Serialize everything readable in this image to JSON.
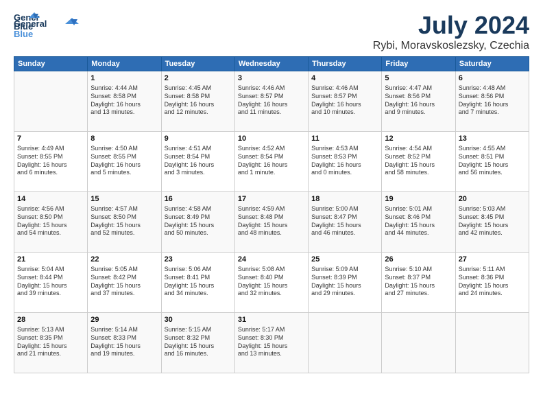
{
  "logo": {
    "line1": "General",
    "line2": "Blue"
  },
  "title": "July 2024",
  "subtitle": "Rybi, Moravskoslezsky, Czechia",
  "days_header": [
    "Sunday",
    "Monday",
    "Tuesday",
    "Wednesday",
    "Thursday",
    "Friday",
    "Saturday"
  ],
  "weeks": [
    [
      {
        "day": "",
        "info": ""
      },
      {
        "day": "1",
        "info": "Sunrise: 4:44 AM\nSunset: 8:58 PM\nDaylight: 16 hours\nand 13 minutes."
      },
      {
        "day": "2",
        "info": "Sunrise: 4:45 AM\nSunset: 8:58 PM\nDaylight: 16 hours\nand 12 minutes."
      },
      {
        "day": "3",
        "info": "Sunrise: 4:46 AM\nSunset: 8:57 PM\nDaylight: 16 hours\nand 11 minutes."
      },
      {
        "day": "4",
        "info": "Sunrise: 4:46 AM\nSunset: 8:57 PM\nDaylight: 16 hours\nand 10 minutes."
      },
      {
        "day": "5",
        "info": "Sunrise: 4:47 AM\nSunset: 8:56 PM\nDaylight: 16 hours\nand 9 minutes."
      },
      {
        "day": "6",
        "info": "Sunrise: 4:48 AM\nSunset: 8:56 PM\nDaylight: 16 hours\nand 7 minutes."
      }
    ],
    [
      {
        "day": "7",
        "info": "Sunrise: 4:49 AM\nSunset: 8:55 PM\nDaylight: 16 hours\nand 6 minutes."
      },
      {
        "day": "8",
        "info": "Sunrise: 4:50 AM\nSunset: 8:55 PM\nDaylight: 16 hours\nand 5 minutes."
      },
      {
        "day": "9",
        "info": "Sunrise: 4:51 AM\nSunset: 8:54 PM\nDaylight: 16 hours\nand 3 minutes."
      },
      {
        "day": "10",
        "info": "Sunrise: 4:52 AM\nSunset: 8:54 PM\nDaylight: 16 hours\nand 1 minute."
      },
      {
        "day": "11",
        "info": "Sunrise: 4:53 AM\nSunset: 8:53 PM\nDaylight: 16 hours\nand 0 minutes."
      },
      {
        "day": "12",
        "info": "Sunrise: 4:54 AM\nSunset: 8:52 PM\nDaylight: 15 hours\nand 58 minutes."
      },
      {
        "day": "13",
        "info": "Sunrise: 4:55 AM\nSunset: 8:51 PM\nDaylight: 15 hours\nand 56 minutes."
      }
    ],
    [
      {
        "day": "14",
        "info": "Sunrise: 4:56 AM\nSunset: 8:50 PM\nDaylight: 15 hours\nand 54 minutes."
      },
      {
        "day": "15",
        "info": "Sunrise: 4:57 AM\nSunset: 8:50 PM\nDaylight: 15 hours\nand 52 minutes."
      },
      {
        "day": "16",
        "info": "Sunrise: 4:58 AM\nSunset: 8:49 PM\nDaylight: 15 hours\nand 50 minutes."
      },
      {
        "day": "17",
        "info": "Sunrise: 4:59 AM\nSunset: 8:48 PM\nDaylight: 15 hours\nand 48 minutes."
      },
      {
        "day": "18",
        "info": "Sunrise: 5:00 AM\nSunset: 8:47 PM\nDaylight: 15 hours\nand 46 minutes."
      },
      {
        "day": "19",
        "info": "Sunrise: 5:01 AM\nSunset: 8:46 PM\nDaylight: 15 hours\nand 44 minutes."
      },
      {
        "day": "20",
        "info": "Sunrise: 5:03 AM\nSunset: 8:45 PM\nDaylight: 15 hours\nand 42 minutes."
      }
    ],
    [
      {
        "day": "21",
        "info": "Sunrise: 5:04 AM\nSunset: 8:44 PM\nDaylight: 15 hours\nand 39 minutes."
      },
      {
        "day": "22",
        "info": "Sunrise: 5:05 AM\nSunset: 8:42 PM\nDaylight: 15 hours\nand 37 minutes."
      },
      {
        "day": "23",
        "info": "Sunrise: 5:06 AM\nSunset: 8:41 PM\nDaylight: 15 hours\nand 34 minutes."
      },
      {
        "day": "24",
        "info": "Sunrise: 5:08 AM\nSunset: 8:40 PM\nDaylight: 15 hours\nand 32 minutes."
      },
      {
        "day": "25",
        "info": "Sunrise: 5:09 AM\nSunset: 8:39 PM\nDaylight: 15 hours\nand 29 minutes."
      },
      {
        "day": "26",
        "info": "Sunrise: 5:10 AM\nSunset: 8:37 PM\nDaylight: 15 hours\nand 27 minutes."
      },
      {
        "day": "27",
        "info": "Sunrise: 5:11 AM\nSunset: 8:36 PM\nDaylight: 15 hours\nand 24 minutes."
      }
    ],
    [
      {
        "day": "28",
        "info": "Sunrise: 5:13 AM\nSunset: 8:35 PM\nDaylight: 15 hours\nand 21 minutes."
      },
      {
        "day": "29",
        "info": "Sunrise: 5:14 AM\nSunset: 8:33 PM\nDaylight: 15 hours\nand 19 minutes."
      },
      {
        "day": "30",
        "info": "Sunrise: 5:15 AM\nSunset: 8:32 PM\nDaylight: 15 hours\nand 16 minutes."
      },
      {
        "day": "31",
        "info": "Sunrise: 5:17 AM\nSunset: 8:30 PM\nDaylight: 15 hours\nand 13 minutes."
      },
      {
        "day": "",
        "info": ""
      },
      {
        "day": "",
        "info": ""
      },
      {
        "day": "",
        "info": ""
      }
    ]
  ]
}
